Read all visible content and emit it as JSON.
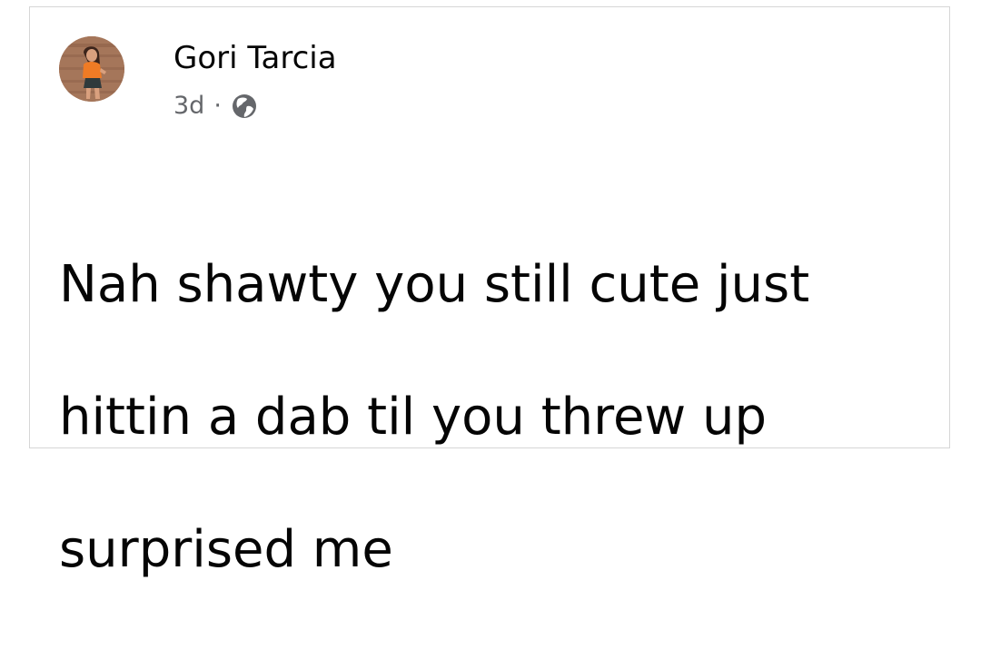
{
  "post": {
    "author": {
      "name": "Gori Tarcia",
      "avatar_icon": "profile-photo"
    },
    "meta": {
      "time": "3d",
      "separator": "·",
      "audience_icon": "globe-icon"
    },
    "text_lines": [
      "Nah shawty you still cute just",
      "hittin a dab til you threw up",
      "surprised me"
    ]
  },
  "colors": {
    "text": "#050505",
    "secondary_text": "#65676b",
    "border": "#d6d6d6",
    "background": "#ffffff"
  }
}
